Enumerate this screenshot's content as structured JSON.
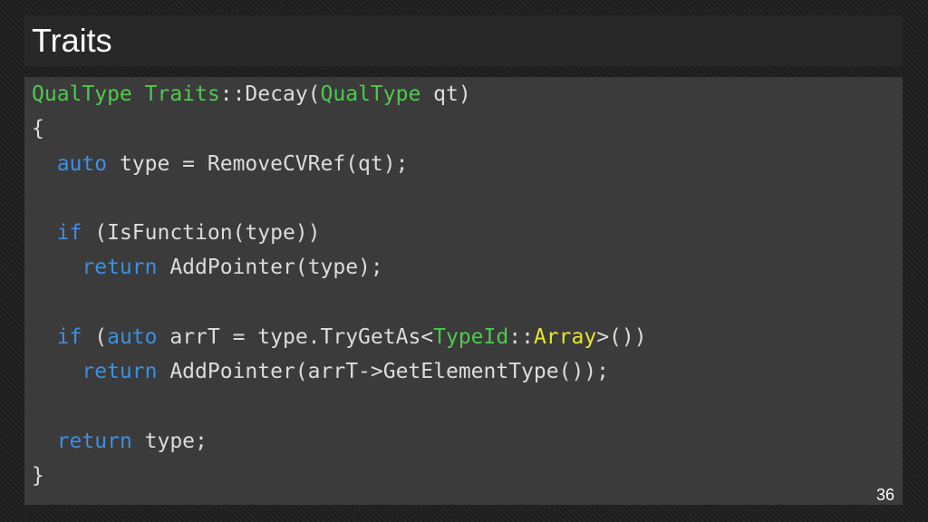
{
  "slide": {
    "title": "Traits",
    "page_number": "36"
  },
  "colors": {
    "type": "#4ec94e",
    "keyword": "#3d8fe0",
    "text": "#dcdcdc",
    "template_arg": "#e6e62e"
  },
  "code": {
    "lines": [
      [
        {
          "text": "QualType",
          "kind": "type"
        },
        {
          "text": " ",
          "kind": "plain"
        },
        {
          "text": "Traits",
          "kind": "type"
        },
        {
          "text": "::Decay(",
          "kind": "plain"
        },
        {
          "text": "QualType",
          "kind": "type"
        },
        {
          "text": " qt)",
          "kind": "plain"
        }
      ],
      [
        {
          "text": "{",
          "kind": "plain"
        }
      ],
      [
        {
          "text": "  ",
          "kind": "plain"
        },
        {
          "text": "auto",
          "kind": "kw"
        },
        {
          "text": " type = RemoveCVRef(qt);",
          "kind": "plain"
        }
      ],
      [],
      [
        {
          "text": "  ",
          "kind": "plain"
        },
        {
          "text": "if",
          "kind": "kw"
        },
        {
          "text": " (IsFunction(type))",
          "kind": "plain"
        }
      ],
      [
        {
          "text": "    ",
          "kind": "plain"
        },
        {
          "text": "return",
          "kind": "kw"
        },
        {
          "text": " AddPointer(type);",
          "kind": "plain"
        }
      ],
      [],
      [
        {
          "text": "  ",
          "kind": "plain"
        },
        {
          "text": "if",
          "kind": "kw"
        },
        {
          "text": " (",
          "kind": "plain"
        },
        {
          "text": "auto",
          "kind": "kw"
        },
        {
          "text": " arrT = type.TryGetAs<",
          "kind": "plain"
        },
        {
          "text": "TypeId",
          "kind": "class"
        },
        {
          "text": "::",
          "kind": "plain"
        },
        {
          "text": "Array",
          "kind": "yellow"
        },
        {
          "text": ">())",
          "kind": "plain"
        }
      ],
      [
        {
          "text": "    ",
          "kind": "plain"
        },
        {
          "text": "return",
          "kind": "kw"
        },
        {
          "text": " AddPointer(arrT->GetElementType());",
          "kind": "plain"
        }
      ],
      [],
      [
        {
          "text": "  ",
          "kind": "plain"
        },
        {
          "text": "return",
          "kind": "kw"
        },
        {
          "text": " type;",
          "kind": "plain"
        }
      ],
      [
        {
          "text": "}",
          "kind": "plain"
        }
      ]
    ]
  }
}
